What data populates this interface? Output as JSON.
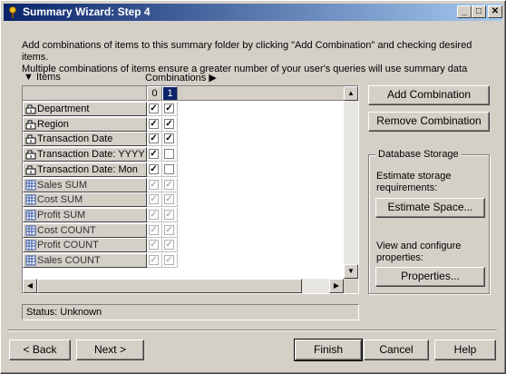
{
  "window": {
    "title": "Summary Wizard: Step 4"
  },
  "description": {
    "line1": "Add combinations of items to this summary folder by clicking \"Add Combination\" and checking desired items.",
    "line2": "Multiple combinations of items ensure a greater number of your user's queries will use summary data"
  },
  "headers": {
    "items": "Items",
    "combinations": "Combinations"
  },
  "columns": [
    "0",
    "1"
  ],
  "rows": [
    {
      "label": "Department",
      "icon": "dimension-icon",
      "c0": "checked",
      "c1": "checked"
    },
    {
      "label": "Region",
      "icon": "dimension-icon",
      "c0": "checked",
      "c1": "checked"
    },
    {
      "label": "Transaction Date",
      "icon": "dimension-icon",
      "c0": "checked",
      "c1": "checked"
    },
    {
      "label": "Transaction Date: YYYY",
      "icon": "dimension-icon",
      "c0": "checked",
      "c1": "unchecked"
    },
    {
      "label": "Transaction Date: Mon",
      "icon": "dimension-icon",
      "c0": "checked",
      "c1": "unchecked"
    },
    {
      "label": "Sales SUM",
      "icon": "measure-icon",
      "c0": "disabled-checked",
      "c1": "disabled-checked"
    },
    {
      "label": "Cost SUM",
      "icon": "measure-icon",
      "c0": "disabled-checked",
      "c1": "disabled-checked"
    },
    {
      "label": "Profit SUM",
      "icon": "measure-icon",
      "c0": "disabled-checked",
      "c1": "disabled-checked"
    },
    {
      "label": "Cost COUNT",
      "icon": "measure-icon",
      "c0": "disabled-checked",
      "c1": "disabled-checked"
    },
    {
      "label": "Profit COUNT",
      "icon": "measure-icon",
      "c0": "disabled-checked",
      "c1": "disabled-checked"
    },
    {
      "label": "Sales COUNT",
      "icon": "measure-icon",
      "c0": "disabled-checked",
      "c1": "disabled-checked"
    }
  ],
  "buttons": {
    "add_combination": "Add Combination",
    "remove_combination": "Remove Combination",
    "estimate_space": "Estimate Space...",
    "properties": "Properties...",
    "back": "Back",
    "next": "Next",
    "finish": "Finish",
    "cancel": "Cancel",
    "help": "Help"
  },
  "storage": {
    "title": "Database Storage",
    "estimate_text": "Estimate storage requirements:",
    "view_text": "View and configure properties:"
  },
  "status": "Status: Unknown",
  "colors": {
    "title_start": "#0a246a",
    "title_end": "#a6caf0",
    "face": "#d4d0c8",
    "selected": "#0a246a"
  }
}
